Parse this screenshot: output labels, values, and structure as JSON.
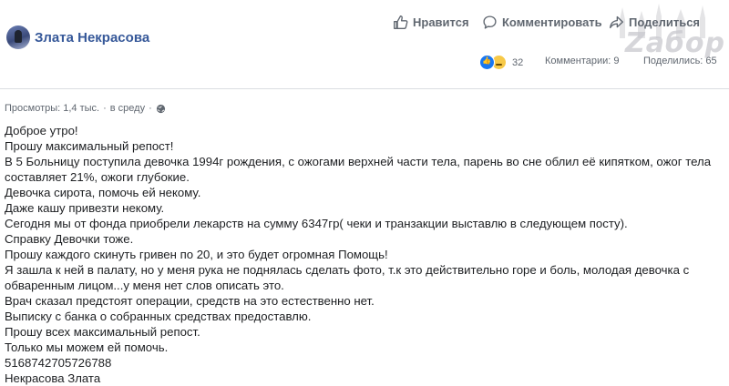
{
  "author": {
    "name": "Злата Некрасова"
  },
  "actions": {
    "like": "Нравится",
    "comment": "Комментировать",
    "share": "Поделиться"
  },
  "watermark": {
    "text": "Zaбор"
  },
  "stats": {
    "reactions_count": "32",
    "comments": "Комментарии: 9",
    "shares": "Поделились: 65"
  },
  "meta": {
    "views": "Просмотры: 1,4 тыс.",
    "sep": "·",
    "date": "в среду",
    "sep2": "·"
  },
  "post": {
    "lines": [
      "Доброе утро!",
      "Прошу максимальный репост!",
      "В 5 Больницу поступила девочка 1994г рождения, с ожогами верхней части тела, парень во сне облил её кипятком, ожог тела",
      "составляет 21%, ожоги глубокие.",
      "Девочка сирота, помочь ей некому.",
      "Даже кашу привезти некому.",
      "Сегодня мы от фонда приобрели лекарств на сумму 6347гр( чеки и транзакции выставлю в следующем посту).",
      "Справку Девочки тоже.",
      "Прошу каждого скинуть гривен по 20, и это будет огромная Помощь!",
      "Я зашла к ней в палату, но у меня рука не поднялась сделать фото, т.к это действительно горе и боль, молодая девочка с",
      "обваренным лицом...у меня нет слов описать это.",
      "Врач сказал предстоят операции, средств на это естественно нет.",
      "Выписку с банка о собранных средствах предоставлю.",
      "Прошу всех максимальный репост.",
      "Только мы можем ей помочь.",
      "5168742705726788",
      "Некрасова Злата"
    ]
  }
}
